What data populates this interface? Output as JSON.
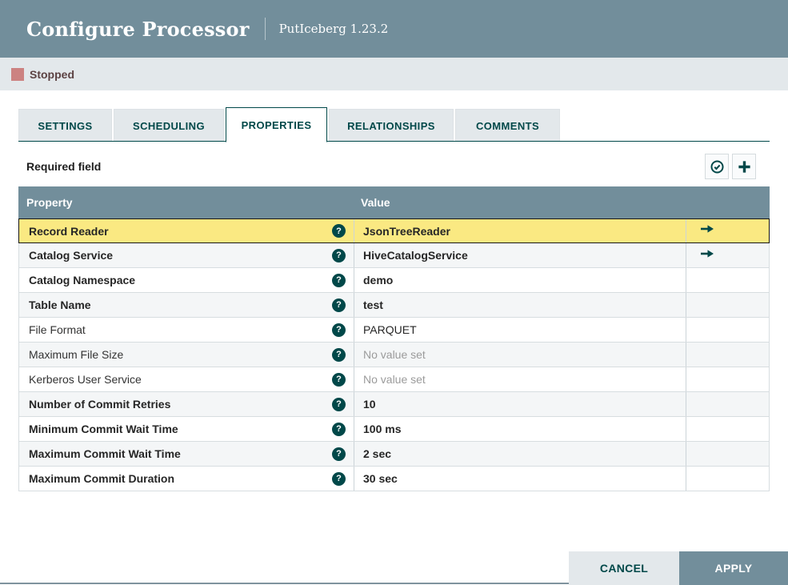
{
  "header": {
    "title": "Configure Processor",
    "subtitle": "PutIceberg 1.23.2"
  },
  "status": {
    "label": "Stopped"
  },
  "tabs": [
    {
      "label": "SETTINGS",
      "active": false
    },
    {
      "label": "SCHEDULING",
      "active": false
    },
    {
      "label": "PROPERTIES",
      "active": true
    },
    {
      "label": "RELATIONSHIPS",
      "active": false
    },
    {
      "label": "COMMENTS",
      "active": false
    }
  ],
  "toolbar": {
    "required_label": "Required field",
    "verify_icon": "circle-check-icon",
    "add_icon": "plus-icon"
  },
  "table": {
    "columns": [
      "Property",
      "Value"
    ],
    "help_glyph": "?",
    "rows": [
      {
        "property": "Record Reader",
        "value": "JsonTreeReader",
        "required": true,
        "selected": true,
        "arrow": true,
        "no_value": false
      },
      {
        "property": "Catalog Service",
        "value": "HiveCatalogService",
        "required": true,
        "selected": false,
        "arrow": true,
        "no_value": false
      },
      {
        "property": "Catalog Namespace",
        "value": "demo",
        "required": true,
        "selected": false,
        "arrow": false,
        "no_value": false
      },
      {
        "property": "Table Name",
        "value": "test",
        "required": true,
        "selected": false,
        "arrow": false,
        "no_value": false
      },
      {
        "property": "File Format",
        "value": "PARQUET",
        "required": false,
        "selected": false,
        "arrow": false,
        "no_value": false
      },
      {
        "property": "Maximum File Size",
        "value": "No value set",
        "required": false,
        "selected": false,
        "arrow": false,
        "no_value": true
      },
      {
        "property": "Kerberos User Service",
        "value": "No value set",
        "required": false,
        "selected": false,
        "arrow": false,
        "no_value": true
      },
      {
        "property": "Number of Commit Retries",
        "value": "10",
        "required": true,
        "selected": false,
        "arrow": false,
        "no_value": false
      },
      {
        "property": "Minimum Commit Wait Time",
        "value": "100 ms",
        "required": true,
        "selected": false,
        "arrow": false,
        "no_value": false
      },
      {
        "property": "Maximum Commit Wait Time",
        "value": "2 sec",
        "required": true,
        "selected": false,
        "arrow": false,
        "no_value": false
      },
      {
        "property": "Maximum Commit Duration",
        "value": "30 sec",
        "required": true,
        "selected": false,
        "arrow": false,
        "no_value": false
      }
    ]
  },
  "footer": {
    "cancel_label": "CANCEL",
    "apply_label": "APPLY"
  },
  "colors": {
    "accent_teal": "#004849",
    "header_slate": "#728e9b",
    "status_bar": "#e3e8eb",
    "stopped_red": "#cc8281",
    "selected_row_yellow": "#fae982",
    "row_alternate": "#f4f6f7"
  }
}
